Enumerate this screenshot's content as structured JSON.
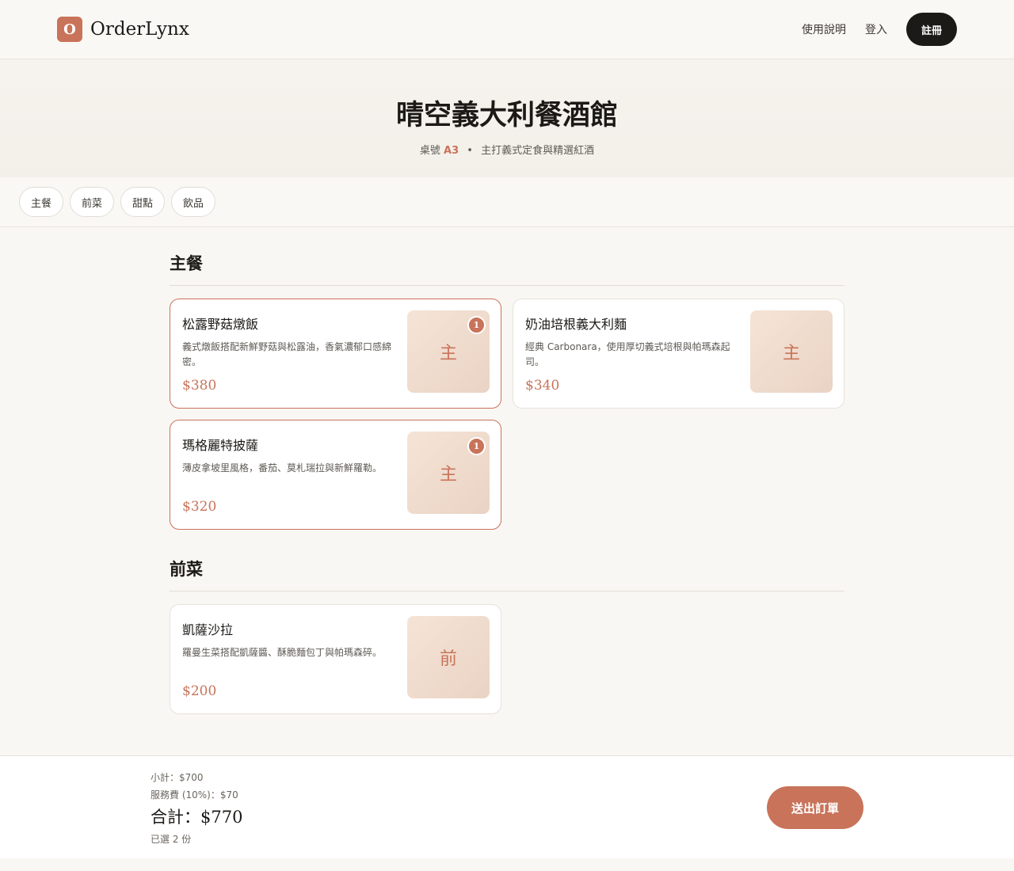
{
  "header": {
    "logo_letter": "O",
    "brand_name": "OrderLynx",
    "nav": {
      "help": "使用說明",
      "login": "登入",
      "signup": "註冊"
    }
  },
  "hero": {
    "restaurant_name": "晴空義大利餐酒館",
    "table_label": "桌號",
    "table_number": "A3",
    "separator": "•",
    "tagline": "主打義式定食與精選紅酒"
  },
  "categories": [
    "主餐",
    "前菜",
    "甜點",
    "飲品"
  ],
  "sections": [
    {
      "title": "主餐",
      "items": [
        {
          "name": "松露野菇燉飯",
          "description": "義式燉飯搭配新鮮野菇與松露油，香氣濃郁口感綿密。",
          "price": "$380",
          "thumb": "主",
          "quantity": "1",
          "selected": true
        },
        {
          "name": "奶油培根義大利麵",
          "description": "經典 Carbonara，使用厚切義式培根與帕瑪森起司。",
          "price": "$340",
          "thumb": "主",
          "quantity": "",
          "selected": false
        },
        {
          "name": "瑪格麗特披薩",
          "description": "薄皮拿坡里風格，番茄、莫札瑞拉與新鮮羅勒。",
          "price": "$320",
          "thumb": "主",
          "quantity": "1",
          "selected": true
        }
      ]
    },
    {
      "title": "前菜",
      "items": [
        {
          "name": "凱薩沙拉",
          "description": "羅曼生菜搭配凱薩醬、酥脆麵包丁與帕瑪森碎。",
          "price": "$200",
          "thumb": "前",
          "quantity": "",
          "selected": false
        }
      ]
    }
  ],
  "order": {
    "subtotal": "小計：$700",
    "service_fee": "服務費 (10%)：$70",
    "total": "合計：$770",
    "count": "已選 2 份",
    "submit_label": "送出訂單"
  },
  "colors": {
    "accent": "#c8735a",
    "dark": "#1c1a17",
    "background": "#f9f7f3"
  }
}
